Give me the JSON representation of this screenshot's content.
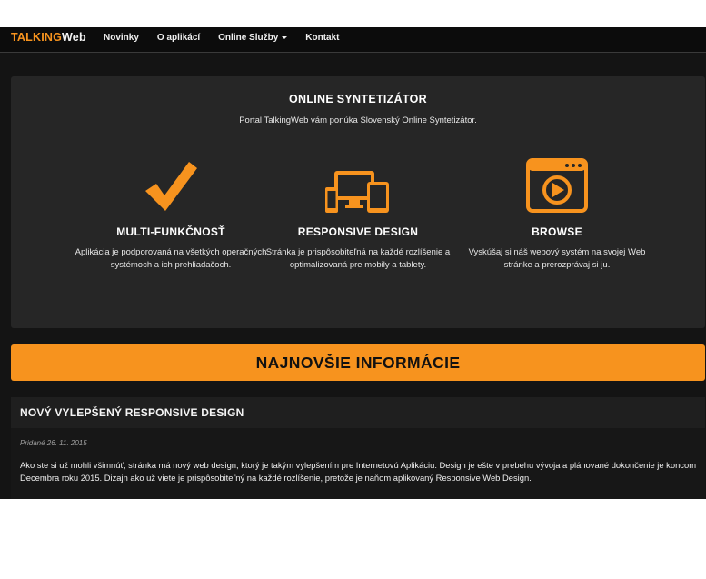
{
  "brand": {
    "part1": "TALKING",
    "part2": "Web"
  },
  "nav": {
    "items": [
      {
        "label": "Novinky"
      },
      {
        "label": "O aplikácí"
      },
      {
        "label": "Online Služby"
      },
      {
        "label": "Kontakt"
      }
    ]
  },
  "hero": {
    "title": "ONLINE SYNTETIZÁTOR",
    "subtitle": "Portal TalkingWeb vám ponúka Slovenský Online Syntetizátor.",
    "features": [
      {
        "icon": "checkmark-icon",
        "title": "MULTI-FUNKČNOSŤ",
        "text": "Aplikácia je podporovaná na všetkých operačných systémoch a ich prehliadačoch."
      },
      {
        "icon": "devices-icon",
        "title": "RESPONSIVE DESIGN",
        "text": "Stránka je prispôsobiteľná na každé rozlíšenie a optimalizovaná pre mobily a tablety."
      },
      {
        "icon": "browser-play-icon",
        "title": "BROWSE",
        "text": "Vyskúšaj si náš webový systém na svojej Web stránke a prerozprávaj si ju."
      }
    ]
  },
  "banner": {
    "title": "NAJNOVŠIE INFORMÁCIE"
  },
  "article": {
    "title": "NOVÝ VYLEPŠENÝ RESPONSIVE DESIGN",
    "date": "Pridané 26. 11. 2015",
    "text": "Ako ste si už mohli všimnúť, stránka má nový web design, ktorý je takým vylepšením pre Internetovú Aplikáciu. Design je ešte v prebehu vývoja a plánované dokončenie je koncom Decembra roku 2015. Dizajn ako už viete je prispôsobiteľný na každé rozlíšenie, pretože je naňom aplikovaný Responsive Web Design."
  },
  "colors": {
    "accent": "#f7931e",
    "background": "#141414",
    "panel": "#262626"
  }
}
